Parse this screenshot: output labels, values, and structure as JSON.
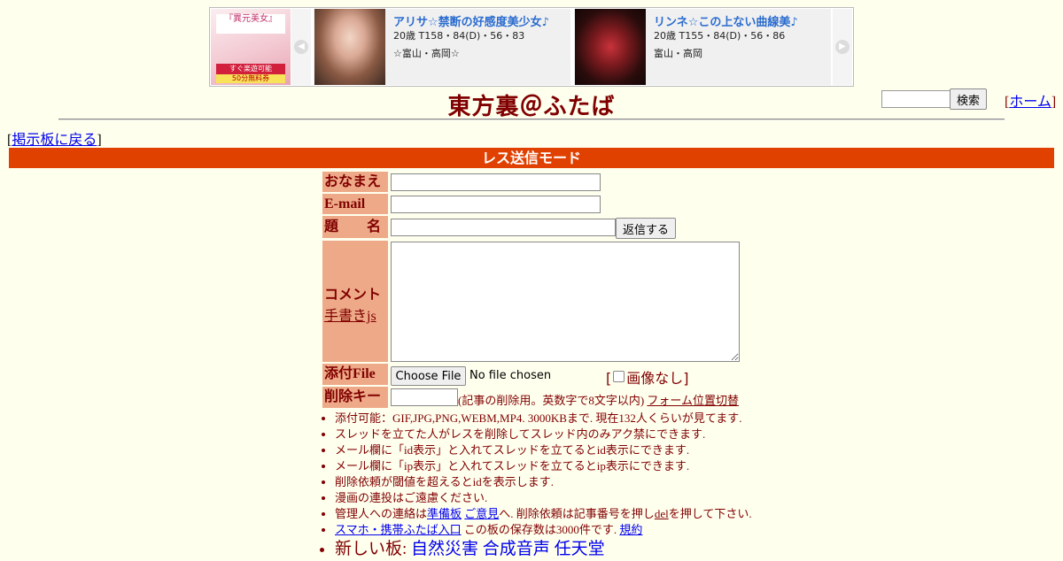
{
  "ad": {
    "side_image": {
      "tag": "『異元美女』",
      "band": "すぐ楽遊可能",
      "band2": "50分無料券"
    },
    "prev_arrow": "◀",
    "next_arrow": "▶",
    "cards": [
      {
        "name": "アリサ☆禁断の好感度美少女♪",
        "spec": "20歳 T158・84(D)・56・83",
        "area": "☆富山・高岡☆"
      },
      {
        "name": "リンネ☆この上ない曲線美♪",
        "spec": "20歳 T155・84(D)・56・86",
        "area": "富山・高岡"
      }
    ]
  },
  "header": {
    "title": "東方裏＠ふたば",
    "search_button": "検索",
    "home_link": "ホーム",
    "back_link": "掲示板に戻る"
  },
  "mode_bar": "レス送信モード",
  "form": {
    "name_label": "おなまえ",
    "email_label": "E-mail",
    "subject_label": "題　　名",
    "reply_button": "返信する",
    "comment_label": "コメント",
    "handwriting_link": "手書きjs",
    "file_label": "添付File",
    "file_button": "Choose File",
    "no_file_text": "No file chosen",
    "no_image_label": "画像なし",
    "delkey_label": "削除キー",
    "delkey_note": "(記事の削除用。英数字で8文字以内)",
    "form_toggle_link": "フォーム位置切替"
  },
  "notes": {
    "n1": "添付可能：GIF,JPG,PNG,WEBM,MP4. 3000KBまで. 現在132人くらいが見てます.",
    "n2": "スレッドを立てた人がレスを削除してスレッド内のみアク禁にできます.",
    "n3": "メール欄に「id表示」と入れてスレッドを立てるとid表示にできます.",
    "n4": "メール欄に「ip表示」と入れてスレッドを立てるとip表示にできます.",
    "n5": "削除依頼が閾値を超えるとidを表示します.",
    "n6": "漫画の連投はご遠慮ください.",
    "n7_pre": "管理人への連絡は",
    "n7_link1": "準備板",
    "n7_link2": "ご意見",
    "n7_mid": "へ. 削除依頼は記事番号を押し",
    "n7_link3": "del",
    "n7_post": "を押して下さい.",
    "n8_link": "スマホ・携帯ふたば入口",
    "n8_mid": "この板の保存数は3000件です.",
    "n8_link2": "規約",
    "n9_pre": "新しい板:",
    "n9_link1": "自然災害",
    "n9_link2": "合成音声",
    "n9_link3": "任天堂"
  },
  "colors": {
    "background": "#ffffee",
    "text": "#800000",
    "mode_bar": "#e04000",
    "label_bg": "#eeaa88",
    "ad_name": "#2a6ccf"
  }
}
